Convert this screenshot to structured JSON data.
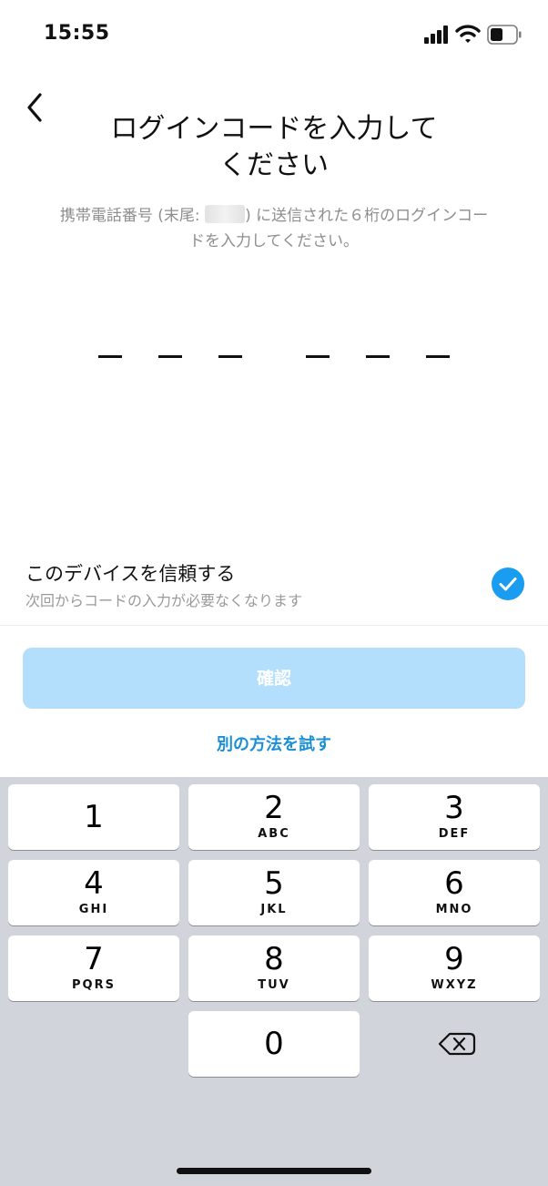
{
  "status_bar": {
    "time": "15:55",
    "battery_level": 0.5
  },
  "header": {
    "back_icon": "chevron-left-icon",
    "title_line1": "ログインコードを入力して",
    "title_line2": "ください",
    "subtitle_prefix": "携帯電話番号 (末尾: ",
    "subtitle_suffix": ") に送信された６桁のログインコー",
    "subtitle_line2": "ドを入力してください。"
  },
  "code_input": {
    "digits": [
      "",
      "",
      "",
      "",
      "",
      ""
    ]
  },
  "trust_device": {
    "title": "このデバイスを信頼する",
    "subtitle": "次回からコードの入力が必要なくなります",
    "checked": true,
    "check_color": "#1a9cf0"
  },
  "confirm_button": {
    "label": "確認",
    "color": "#b3dffc",
    "enabled": false
  },
  "alt_method_link": {
    "label": "別の方法を試す",
    "color": "#1a8fd8"
  },
  "keypad": {
    "keys": [
      {
        "digit": "1",
        "letters": ""
      },
      {
        "digit": "2",
        "letters": "ABC"
      },
      {
        "digit": "3",
        "letters": "DEF"
      },
      {
        "digit": "4",
        "letters": "GHI"
      },
      {
        "digit": "5",
        "letters": "JKL"
      },
      {
        "digit": "6",
        "letters": "MNO"
      },
      {
        "digit": "7",
        "letters": "PQRS"
      },
      {
        "digit": "8",
        "letters": "TUV"
      },
      {
        "digit": "9",
        "letters": "WXYZ"
      },
      {
        "digit": "0",
        "letters": ""
      }
    ],
    "delete_icon": "backspace-icon"
  }
}
